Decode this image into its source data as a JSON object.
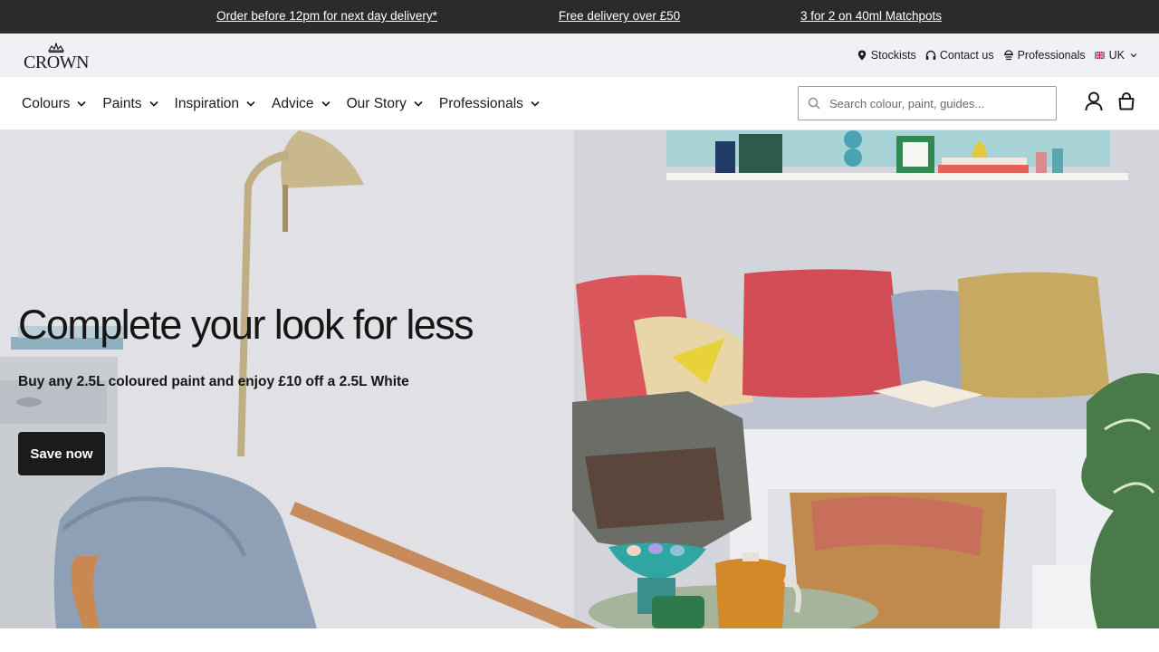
{
  "promo": {
    "item1": "Order before 12pm for next day delivery*",
    "item2": "Free delivery over £50",
    "item3": "3 for 2 on 40ml Matchpots"
  },
  "brand": {
    "logo_text": "CROWN"
  },
  "utility": {
    "stockists": "Stockists",
    "contact": "Contact us",
    "professionals": "Professionals",
    "language": "UK"
  },
  "nav": {
    "items": [
      {
        "label": "Colours"
      },
      {
        "label": "Paints"
      },
      {
        "label": "Inspiration"
      },
      {
        "label": "Advice"
      },
      {
        "label": "Our Story"
      },
      {
        "label": "Professionals"
      }
    ]
  },
  "search": {
    "placeholder": "Search colour, paint, guides..."
  },
  "hero": {
    "title": "Complete your look for less",
    "subtitle": "Buy any 2.5L coloured paint and enjoy £10 off a 2.5L White",
    "cta": "Save now"
  },
  "icons": {
    "stockists": "location-pin-icon",
    "contact": "headphones-icon",
    "professionals": "professionals-icon",
    "language": "uk-flag-icon",
    "search": "search-icon",
    "account": "user-icon",
    "basket": "basket-icon"
  },
  "colors": {
    "promo_bg": "#2a2c2b",
    "utility_bg": "#f0f1f4",
    "cta_bg": "#1b1b1b"
  }
}
